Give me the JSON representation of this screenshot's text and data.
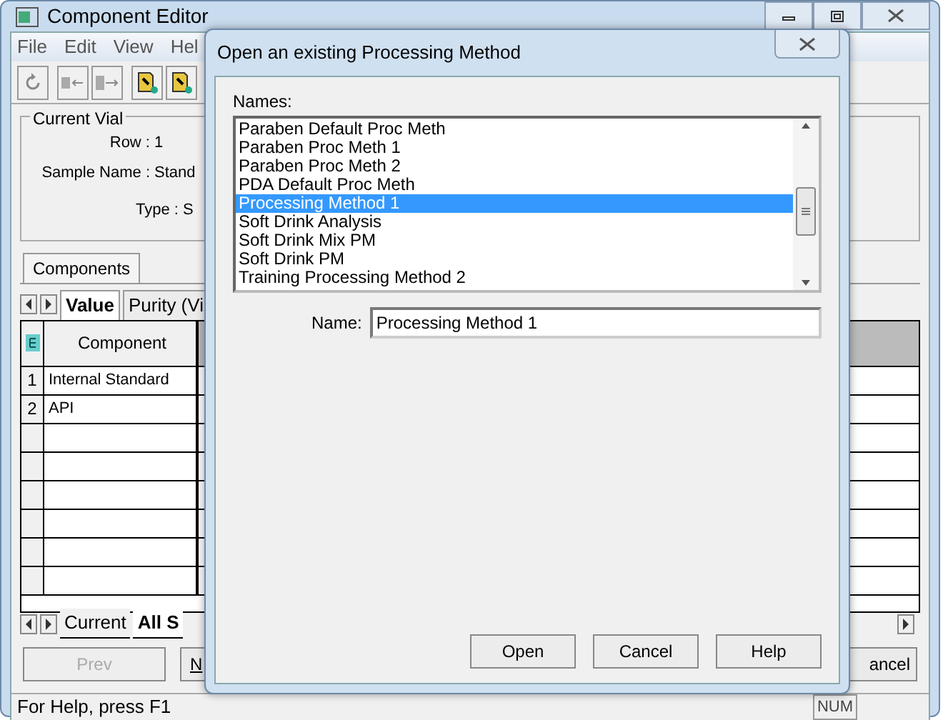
{
  "main_window": {
    "title": "Component Editor",
    "menu": [
      "File",
      "Edit",
      "View",
      "Hel"
    ],
    "current_vial": {
      "label": "Current Vial",
      "fields": [
        {
          "label": "Row :",
          "value": "1"
        },
        {
          "label": "Sample Name :",
          "value": "Stand"
        },
        {
          "label": "Type :",
          "value": "S"
        }
      ]
    },
    "components_tab": "Components",
    "sub_tabs": [
      {
        "label": "Value",
        "selected": true
      },
      {
        "label": "Purity (Vi",
        "selected": false
      }
    ],
    "table": {
      "columns": [
        "Component"
      ],
      "rows": [
        {
          "index": "1",
          "component": "Internal Standard"
        },
        {
          "index": "2",
          "component": "API"
        }
      ]
    },
    "sheet_tabs": [
      {
        "label": "Current",
        "selected": false
      },
      {
        "label": "All S",
        "selected": true
      }
    ],
    "buttons": [
      {
        "label": "Prev",
        "disabled": true
      },
      {
        "label": "N",
        "disabled": false
      },
      {
        "label": "ancel",
        "disabled": false
      }
    ],
    "status_bar": {
      "text": "For Help, press F1",
      "indicator": "NUM"
    }
  },
  "dialog": {
    "title": "Open an existing Processing Method",
    "names_label": "Names:",
    "names": [
      {
        "label": "Paraben Default Proc Meth",
        "selected": false
      },
      {
        "label": "Paraben Proc Meth 1",
        "selected": false
      },
      {
        "label": "Paraben Proc Meth 2",
        "selected": false
      },
      {
        "label": "PDA Default Proc Meth",
        "selected": false
      },
      {
        "label": "Processing Method 1",
        "selected": true
      },
      {
        "label": "Soft Drink Analysis",
        "selected": false
      },
      {
        "label": "Soft Drink Mix PM",
        "selected": false
      },
      {
        "label": "Soft Drink PM",
        "selected": false
      },
      {
        "label": "Training Processing Method 2",
        "selected": false
      }
    ],
    "name_label": "Name:",
    "name_value": "Processing Method 1",
    "buttons": [
      "Open",
      "Cancel",
      "Help"
    ]
  }
}
